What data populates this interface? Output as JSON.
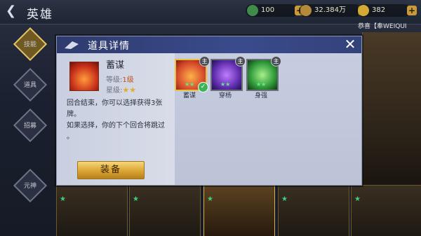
{
  "topbar": {
    "back_icon": "back-arrow-icon",
    "title": "英雄",
    "resources": [
      {
        "icon": "green-scroll-icon",
        "value": "100",
        "color": "#5fbf6a"
      },
      {
        "icon": "copper-coin-icon",
        "value": "32.384万",
        "color": "#c8a04c"
      },
      {
        "icon": "gold-ingot-icon",
        "value": "382",
        "color": "#e0b840"
      }
    ]
  },
  "sidebar": {
    "items": [
      {
        "label": "技能",
        "active": true
      },
      {
        "label": "道具",
        "active": false
      },
      {
        "label": "招募",
        "active": false
      },
      {
        "label": "元神",
        "active": false
      }
    ]
  },
  "marquee": "恭喜【奉WEIQUI",
  "modal": {
    "title": "道具详情",
    "close_icon": "close-icon",
    "item": {
      "name": "蓄谋",
      "level_label": "等级:",
      "level_value": "1级",
      "stars_label": "星级:",
      "stars": "★★"
    },
    "description_lines": [
      "回合结束，你可以选择获得3张",
      "牌。",
      "如果选择，你的下个回合将跳过",
      "。"
    ],
    "equip_button": "装备",
    "cards": [
      {
        "label": "蓄谋",
        "stars": "★★",
        "badge": "主",
        "selected": true,
        "frame": "gold",
        "color": "#e06a2a"
      },
      {
        "label": "穿杨",
        "stars": "★★",
        "badge": "主",
        "selected": false,
        "frame": "gray",
        "color": "#6b3ab8"
      },
      {
        "label": "身强",
        "stars": "★★",
        "badge": "主",
        "selected": false,
        "frame": "gray",
        "color": "#2f9a3a"
      }
    ]
  }
}
